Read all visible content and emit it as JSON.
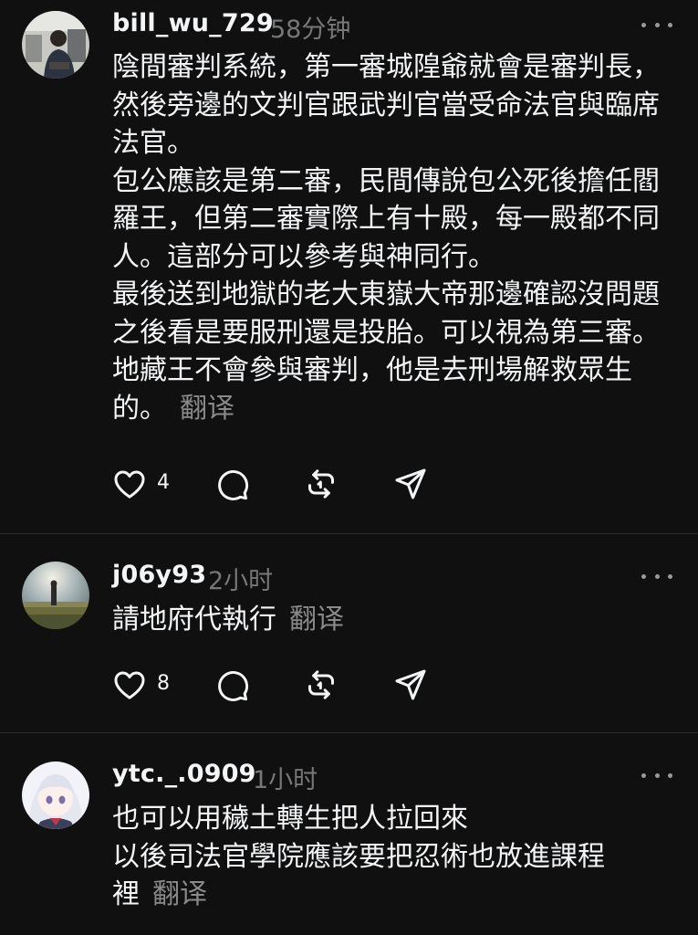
{
  "posts": [
    {
      "username": "bill_wu_729",
      "time": "58分钟",
      "paragraphs": [
        "陰間審判系統，第一審城隍爺就會是審判長，然後旁邊的文判官跟武判官當受命法官與臨席法官。",
        "包公應該是第二審，民間傳說包公死後擔任閻羅王，但第二審實際上有十殿，每一殿都不同人。這部分可以參考與神同行。",
        "最後送到地獄的老大東嶽大帝那邊確認沒問題之後看是要服刑還是投胎。可以視為第三審。",
        "地藏王不會參與審判，他是去刑場解救眾生的。"
      ],
      "translate_label": "翻译",
      "like_count": "4"
    },
    {
      "username": "j06y93",
      "time": "2小时",
      "paragraphs": [
        "請地府代執行"
      ],
      "translate_label": "翻译",
      "like_count": "8"
    },
    {
      "username": "ytc._.0909",
      "time": "1小时",
      "paragraphs": [
        "也可以用穢土轉生把人拉回來",
        "以後司法官學院應該要把忍術也放進課程裡"
      ],
      "translate_label": "翻译"
    }
  ],
  "icons": {
    "like": "heart-icon",
    "reply": "comment-icon",
    "repost": "repost-icon",
    "share": "send-icon",
    "more": "more-options-icon"
  },
  "colors": {
    "background": "#101010",
    "text_primary": "#f3f5f7",
    "text_secondary": "#777777",
    "divider": "#2d2d2d"
  }
}
